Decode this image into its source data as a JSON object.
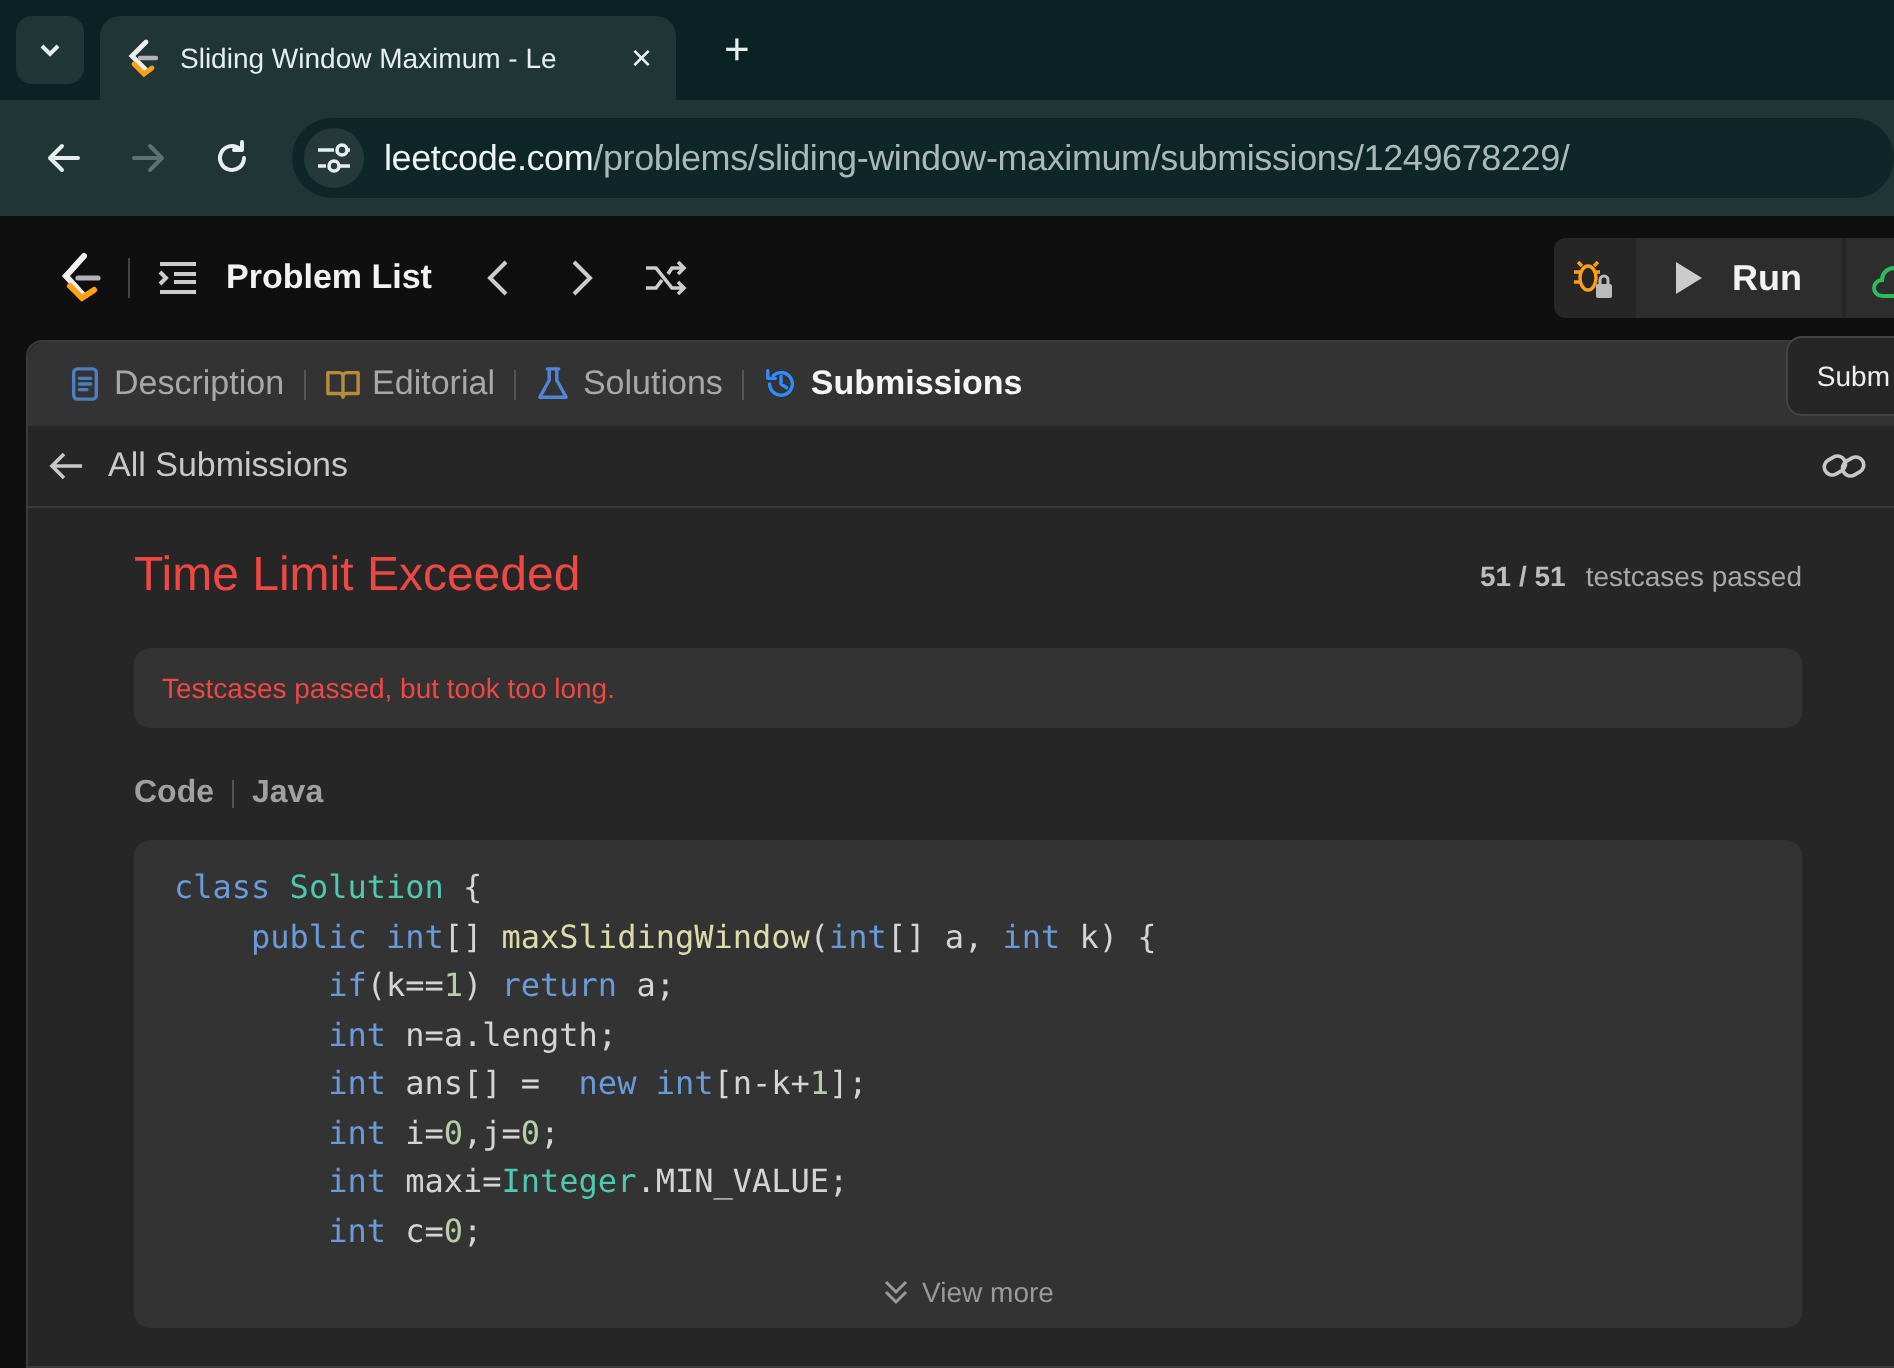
{
  "browser": {
    "tab": {
      "title": "Sliding Window Maximum - Le",
      "close": "×"
    },
    "new_tab": "+",
    "nav_buttons": [
      {
        "kind": "back",
        "disabled": false
      },
      {
        "kind": "forward",
        "disabled": true
      },
      {
        "kind": "reload",
        "disabled": false
      }
    ],
    "address": {
      "host": "leetcode.com",
      "path": "/problems/sliding-window-maximum/submissions/1249678229/"
    }
  },
  "nav": {
    "title": "Problem List",
    "run_label": "Run"
  },
  "panel": {
    "tabs": [
      {
        "kind": "description",
        "label": "Description",
        "selected": false
      },
      {
        "kind": "editorial",
        "label": "Editorial",
        "selected": false
      },
      {
        "kind": "solutions",
        "label": "Solutions",
        "selected": false
      },
      {
        "kind": "submissions",
        "label": "Submissions",
        "selected": true
      }
    ],
    "tooltip": "Subm",
    "back_label": "All Submissions",
    "result": {
      "status": "Time Limit Exceeded",
      "passed": "51 / 51",
      "passed_label": "testcases passed",
      "message": "Testcases passed, but took too long."
    },
    "code": {
      "label": "Code",
      "language": "Java",
      "more": "View more",
      "lines": [
        [
          {
            "kind": "keyword",
            "text": "class"
          },
          {
            "kind": "class",
            "text": " Solution"
          },
          {
            "kind": "plain",
            "text": " {"
          }
        ],
        [
          {
            "kind": "keyword",
            "text": "    public"
          },
          {
            "kind": "keyword",
            "text": " int"
          },
          {
            "kind": "plain",
            "text": "[] "
          },
          {
            "kind": "function",
            "text": "maxSlidingWindow"
          },
          {
            "kind": "plain",
            "text": "("
          },
          {
            "kind": "keyword",
            "text": "int"
          },
          {
            "kind": "plain",
            "text": "[] a, "
          },
          {
            "kind": "keyword",
            "text": "int"
          },
          {
            "kind": "plain",
            "text": " k) {"
          }
        ],
        [
          {
            "kind": "keyword",
            "text": "        if"
          },
          {
            "kind": "plain",
            "text": "(k=="
          },
          {
            "kind": "number",
            "text": "1"
          },
          {
            "kind": "plain",
            "text": ") "
          },
          {
            "kind": "keyword",
            "text": "return"
          },
          {
            "kind": "plain",
            "text": " a;"
          }
        ],
        [
          {
            "kind": "keyword",
            "text": "        int"
          },
          {
            "kind": "plain",
            "text": " n=a.length;"
          }
        ],
        [
          {
            "kind": "keyword",
            "text": "        int"
          },
          {
            "kind": "plain",
            "text": " ans[] =  "
          },
          {
            "kind": "keyword",
            "text": "new"
          },
          {
            "kind": "keyword",
            "text": " int"
          },
          {
            "kind": "plain",
            "text": "[n-k+"
          },
          {
            "kind": "number",
            "text": "1"
          },
          {
            "kind": "plain",
            "text": "];"
          }
        ],
        [
          {
            "kind": "keyword",
            "text": "        int"
          },
          {
            "kind": "plain",
            "text": " i="
          },
          {
            "kind": "number",
            "text": "0"
          },
          {
            "kind": "plain",
            "text": ",j="
          },
          {
            "kind": "number",
            "text": "0"
          },
          {
            "kind": "plain",
            "text": ";"
          }
        ],
        [
          {
            "kind": "keyword",
            "text": "        int"
          },
          {
            "kind": "plain",
            "text": " maxi="
          },
          {
            "kind": "class",
            "text": "Integer"
          },
          {
            "kind": "plain",
            "text": ".MIN_VALUE;"
          }
        ],
        [
          {
            "kind": "keyword",
            "text": "        int"
          },
          {
            "kind": "plain",
            "text": " c="
          },
          {
            "kind": "number",
            "text": "0"
          },
          {
            "kind": "plain",
            "text": ";"
          }
        ]
      ]
    }
  }
}
